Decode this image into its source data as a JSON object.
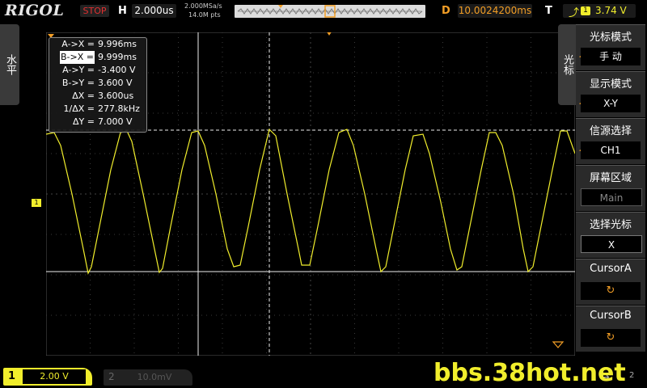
{
  "top_bar": {
    "logo": "RIGOL",
    "run_state": "STOP",
    "h_label": "H",
    "h_scale": "2.000us",
    "sample_rate": "2.000MSa/s",
    "memory_depth": "14.0M pts",
    "d_label": "D",
    "delay": "10.0024200ms",
    "t_label": "T",
    "trigger_source": "1",
    "trigger_level": "3.74 V",
    "trigger_icon": "rising-edge-icon"
  },
  "left_tab": {
    "label": "水平"
  },
  "channel_marker": "1",
  "cursor_readout": {
    "rows": [
      {
        "label": "A->X =",
        "value": "9.996ms"
      },
      {
        "label": "B->X =",
        "value": "9.999ms"
      },
      {
        "label": "A->Y =",
        "value": "-3.400 V"
      },
      {
        "label": "B->Y =",
        "value": "3.600 V"
      },
      {
        "label": "ΔX =",
        "value": "3.600us"
      },
      {
        "label": "1/ΔX =",
        "value": "277.8kHz"
      },
      {
        "label": "ΔY =",
        "value": "7.000 V"
      }
    ]
  },
  "menu": {
    "tab_label": "光标",
    "items": [
      {
        "title": "光标模式",
        "value": "手 动"
      },
      {
        "title": "显示模式",
        "value": "X-Y"
      },
      {
        "title": "信源选择",
        "value": "CH1"
      },
      {
        "title": "屏幕区域",
        "value": "Main"
      },
      {
        "title": "选择光标",
        "value": "X"
      },
      {
        "title": "CursorA",
        "value": "↻"
      },
      {
        "title": "CursorB",
        "value": "↻"
      }
    ]
  },
  "bottom_bar": {
    "ch1_number": "1",
    "ch1_scale": "2.00 V",
    "ch2_number": "2",
    "ch2_scale": "10.0mV",
    "watermark": "bbs.38hot.net",
    "page_num": "2"
  },
  "colors": {
    "ch1": "#f1ee2c",
    "accent": "#f29e26",
    "stop": "#e03030"
  }
}
